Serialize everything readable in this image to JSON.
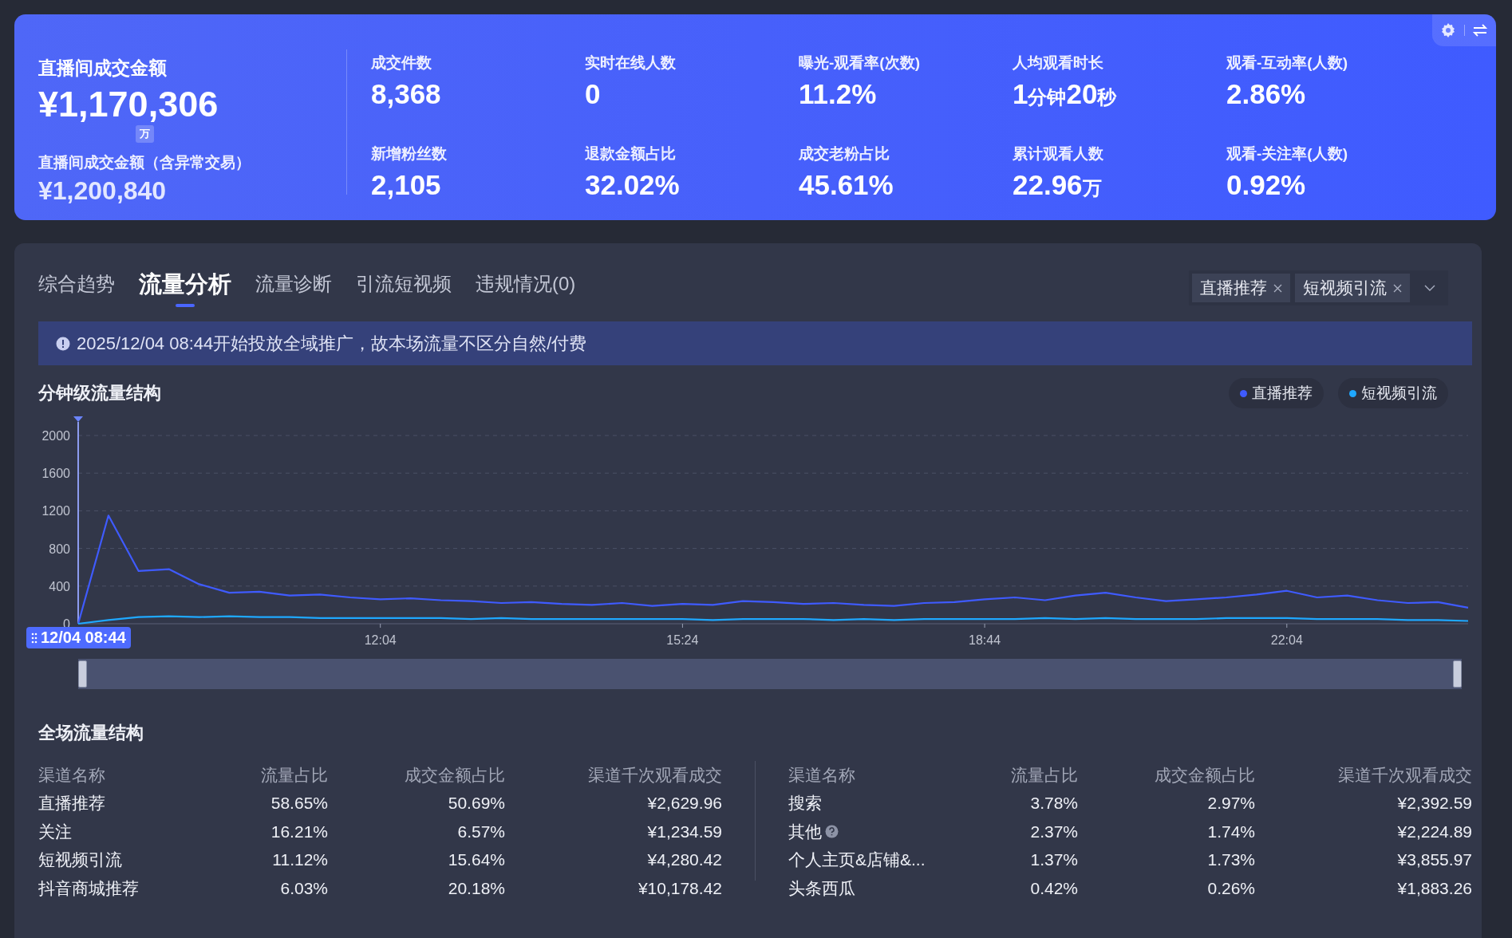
{
  "summary": {
    "main_label": "直播间成交金额",
    "main_value": "¥1,170,306",
    "unit_badge": "万",
    "sub_label": "直播间成交金额（含异常交易）",
    "sub_value": "¥1,200,840"
  },
  "metrics": [
    {
      "label": "成交件数",
      "value": "8,368"
    },
    {
      "label": "实时在线人数",
      "value": "0"
    },
    {
      "label": "曝光-观看率(次数)",
      "value": "11.2%"
    },
    {
      "label": "人均观看时长",
      "value": "1分钟20秒"
    },
    {
      "label": "观看-互动率(人数)",
      "value": "2.86%"
    },
    {
      "label": "新增粉丝数",
      "value": "2,105"
    },
    {
      "label": "退款金额占比",
      "value": "32.02%"
    },
    {
      "label": "成交老粉占比",
      "value": "45.61%"
    },
    {
      "label": "累计观看人数",
      "value": "22.96万"
    },
    {
      "label": "观看-关注率(人数)",
      "value": "0.92%"
    }
  ],
  "tabs": [
    {
      "label": "综合趋势",
      "selected": false
    },
    {
      "label": "流量分析",
      "selected": true
    },
    {
      "label": "流量诊断",
      "selected": false
    },
    {
      "label": "引流短视频",
      "selected": false
    },
    {
      "label": "违规情况(0)",
      "selected": false
    }
  ],
  "filter_tags": [
    {
      "label": "直播推荐"
    },
    {
      "label": "短视频引流"
    }
  ],
  "notice": {
    "text": "2025/12/04 08:44开始投放全域推广，故本场流量不区分自然/付费"
  },
  "minute_chart": {
    "title": "分钟级流量结构",
    "start_label": "12/04 08:44",
    "chart_data": {
      "type": "line",
      "categories": [
        null,
        null,
        null,
        null,
        null,
        null,
        null,
        null,
        null,
        null,
        "12:04",
        null,
        null,
        null,
        null,
        null,
        null,
        null,
        null,
        null,
        "15:24",
        null,
        null,
        null,
        null,
        null,
        null,
        null,
        null,
        null,
        "18:44",
        null,
        null,
        null,
        null,
        null,
        null,
        null,
        null,
        null,
        "22:04",
        null,
        null,
        null,
        null,
        null,
        null
      ],
      "series": [
        {
          "name": "直播推荐",
          "color": "#3f5bff",
          "values": [
            0,
            1150,
            560,
            580,
            420,
            330,
            340,
            300,
            310,
            280,
            260,
            270,
            250,
            240,
            220,
            230,
            210,
            200,
            220,
            190,
            210,
            200,
            240,
            230,
            210,
            220,
            200,
            190,
            220,
            230,
            260,
            280,
            250,
            300,
            330,
            280,
            240,
            260,
            280,
            310,
            350,
            280,
            300,
            250,
            220,
            230,
            170
          ]
        },
        {
          "name": "短视频引流",
          "color": "#1fa8ff",
          "values": [
            0,
            40,
            70,
            80,
            70,
            80,
            70,
            70,
            60,
            60,
            60,
            60,
            60,
            50,
            60,
            50,
            50,
            50,
            50,
            50,
            50,
            40,
            50,
            50,
            50,
            40,
            50,
            40,
            50,
            50,
            50,
            50,
            60,
            50,
            60,
            50,
            50,
            50,
            60,
            60,
            60,
            50,
            50,
            50,
            40,
            40,
            30
          ]
        }
      ],
      "ylim": [
        0,
        2000
      ],
      "grid": true,
      "yticks": [
        0,
        400,
        800,
        1200,
        1600,
        2000
      ]
    },
    "range_slider": {
      "level": 1
    }
  },
  "overall": {
    "title": "全场流量结构",
    "tables": [
      {
        "columns": [
          "渠道名称",
          "流量占比",
          "成交金额占比",
          "渠道千次观看成交"
        ],
        "rows": [
          {
            "cells": [
              "直播推荐",
              "58.65%",
              "50.69%",
              "¥2,629.96"
            ],
            "help": false
          },
          {
            "cells": [
              "关注",
              "16.21%",
              "6.57%",
              "¥1,234.59"
            ],
            "help": false
          },
          {
            "cells": [
              "短视频引流",
              "11.12%",
              "15.64%",
              "¥4,280.42"
            ],
            "help": false
          },
          {
            "cells": [
              "抖音商城推荐",
              "6.03%",
              "20.18%",
              "¥10,178.42"
            ],
            "help": false
          }
        ]
      },
      {
        "columns": [
          "渠道名称",
          "流量占比",
          "成交金额占比",
          "渠道千次观看成交"
        ],
        "rows": [
          {
            "cells": [
              "搜索",
              "3.78%",
              "2.97%",
              "¥2,392.59"
            ],
            "help": false
          },
          {
            "cells": [
              "其他",
              "2.37%",
              "1.74%",
              "¥2,224.89"
            ],
            "help": true
          },
          {
            "cells": [
              "个人主页&店铺&...",
              "1.37%",
              "1.73%",
              "¥3,855.97"
            ],
            "help": false
          },
          {
            "cells": [
              "头条西瓜",
              "0.42%",
              "0.26%",
              "¥1,883.26"
            ],
            "help": false
          }
        ]
      }
    ]
  }
}
